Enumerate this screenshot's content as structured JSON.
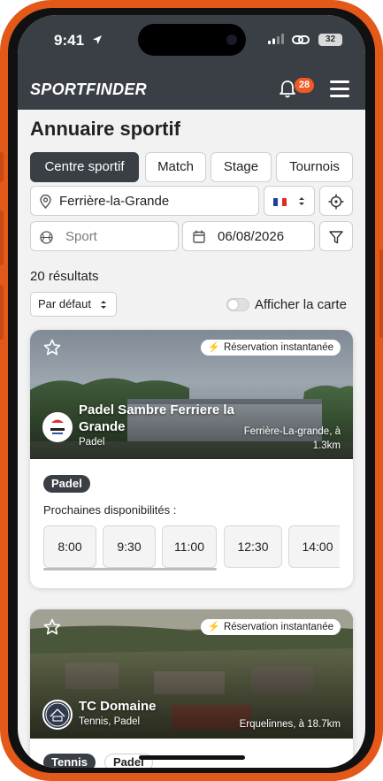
{
  "status": {
    "time": "9:41",
    "battery": "32"
  },
  "app": {
    "logo": "SPORTFINDER",
    "notifications_count": "28",
    "colors": {
      "header": "#3a3f45",
      "accent": "#f05a22"
    }
  },
  "page": {
    "title": "Annuaire sportif"
  },
  "tabs": [
    {
      "label": "Centre sportif",
      "active": true
    },
    {
      "label": "Match",
      "active": false
    },
    {
      "label": "Stage",
      "active": false
    },
    {
      "label": "Tournois",
      "active": false
    }
  ],
  "filters": {
    "location_value": "Ferrière-la-Grande",
    "country_flag": "FR",
    "sport_placeholder": "Sport",
    "date_value": "06/08/2026"
  },
  "results": {
    "count_label": "20 résultats",
    "sort_label": "Par défaut",
    "map_toggle_label": "Afficher la carte",
    "map_toggle_on": false
  },
  "cards": [
    {
      "instant_label": "Réservation instantanée",
      "name": "Padel Sambre Ferriere la Grande",
      "sports": "Padel",
      "location": "Ferrière-La-grande, à 1.3km",
      "chips": [
        "Padel"
      ],
      "availability_label": "Prochaines disponibilités :",
      "slots": [
        "8:00",
        "9:30",
        "11:00",
        "12:30",
        "14:00"
      ]
    },
    {
      "instant_label": "Réservation instantanée",
      "name": "TC Domaine",
      "sports": "Tennis, Padel",
      "location": "Erquelinnes, à 18.7km",
      "chips": [
        "Tennis",
        "Padel"
      ]
    }
  ]
}
